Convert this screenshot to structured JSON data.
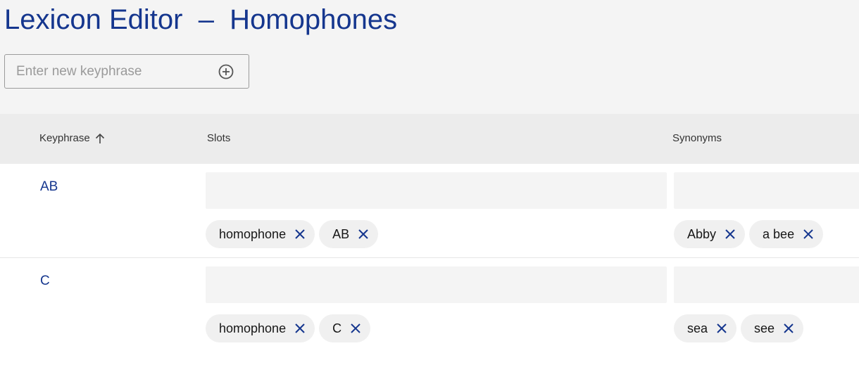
{
  "page": {
    "title": "Lexicon Editor  –  Homophones"
  },
  "new_keyphrase": {
    "placeholder": "Enter new keyphrase",
    "value": ""
  },
  "table": {
    "columns": {
      "keyphrase": "Keyphrase",
      "slots": "Slots",
      "synonyms": "Synonyms"
    },
    "sort": "ascending",
    "rows": [
      {
        "keyphrase": "AB",
        "slots": [
          "homophone",
          "AB"
        ],
        "synonyms": [
          "Abby",
          "a bee"
        ]
      },
      {
        "keyphrase": "C",
        "slots": [
          "homophone",
          "C"
        ],
        "synonyms": [
          "sea",
          "see"
        ]
      }
    ]
  },
  "colors": {
    "accent": "#15368e",
    "page_background": "#f4f4f4",
    "header_background": "#ececec",
    "tag_background": "#f0f0f0"
  },
  "icons": {
    "add": "add-circle-icon",
    "sort": "arrow-up-icon",
    "remove": "close-icon"
  }
}
